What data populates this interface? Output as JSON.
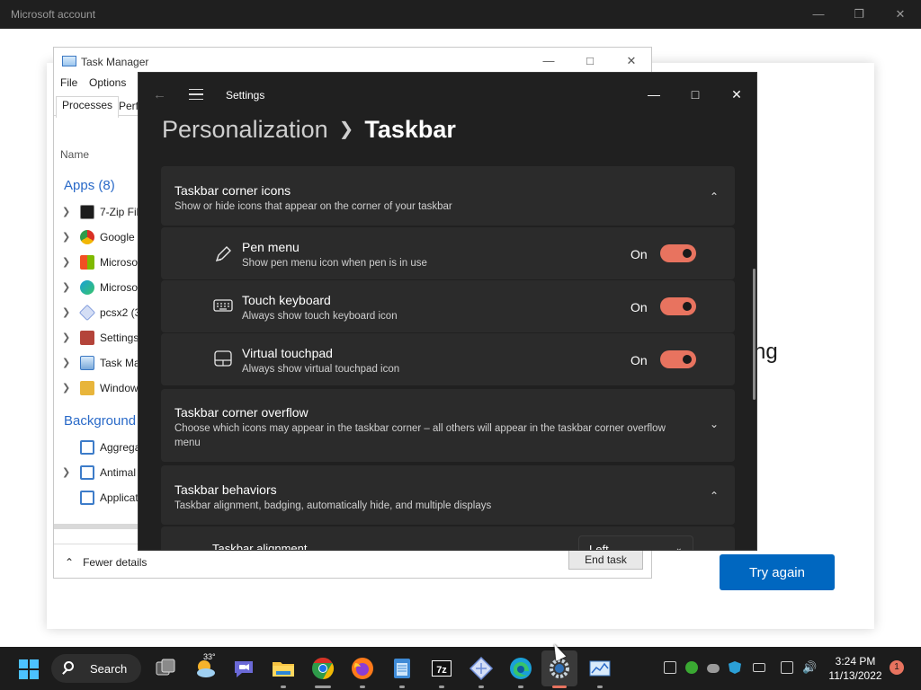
{
  "ms_window": {
    "title": "Microsoft account",
    "heading_fragment": "ng",
    "try_again_label": "Try again"
  },
  "task_manager": {
    "title": "Task Manager",
    "menu": [
      "File",
      "Options"
    ],
    "tabs": [
      "Processes",
      "Perf"
    ],
    "column_name": "Name",
    "apps_header": "Apps (8)",
    "apps": [
      {
        "name": "7-Zip Fil",
        "icon": "7zip-icon",
        "color": "#1d1d1d"
      },
      {
        "name": "Google",
        "icon": "chrome-icon",
        "color": "#2e9b4a"
      },
      {
        "name": "Microso",
        "icon": "microsoft-icon",
        "color": "#e04a1f"
      },
      {
        "name": "Microso",
        "icon": "edge-icon",
        "color": "#1aa0d8"
      },
      {
        "name": "pcsx2 (3",
        "icon": "pcsx2-icon",
        "color": "#6d8cd6"
      },
      {
        "name": "Settings",
        "icon": "settings-icon",
        "color": "#b4443a"
      },
      {
        "name": "Task Ma",
        "icon": "task-manager-icon",
        "color": "#7aa9d9"
      },
      {
        "name": "Window",
        "icon": "folder-icon",
        "color": "#e8b53b"
      }
    ],
    "background_header": "Background",
    "background": [
      {
        "name": "Aggrega",
        "icon": "process-icon",
        "color": "#3d7cc9",
        "expandable": false
      },
      {
        "name": "Antimal",
        "icon": "process-icon",
        "color": "#3d7cc9",
        "expandable": true
      },
      {
        "name": "Applicat",
        "icon": "process-icon",
        "color": "#3d7cc9",
        "expandable": false
      }
    ],
    "fewer_details": "Fewer details",
    "end_task": "End task"
  },
  "settings": {
    "app_title": "Settings",
    "breadcrumb_parent": "Personalization",
    "breadcrumb_current": "Taskbar",
    "corner_icons": {
      "title": "Taskbar corner icons",
      "desc": "Show or hide icons that appear on the corner of your taskbar",
      "items": [
        {
          "title": "Pen menu",
          "desc": "Show pen menu icon when pen is in use",
          "state": "On",
          "icon": "pen-icon"
        },
        {
          "title": "Touch keyboard",
          "desc": "Always show touch keyboard icon",
          "state": "On",
          "icon": "keyboard-icon"
        },
        {
          "title": "Virtual touchpad",
          "desc": "Always show virtual touchpad icon",
          "state": "On",
          "icon": "touchpad-icon"
        }
      ]
    },
    "corner_overflow": {
      "title": "Taskbar corner overflow",
      "desc": "Choose which icons may appear in the taskbar corner – all others will appear in the taskbar corner overflow menu"
    },
    "behaviors": {
      "title": "Taskbar behaviors",
      "desc": "Taskbar alignment, badging, automatically hide, and multiple displays"
    },
    "alignment_label": "Taskbar alignment",
    "alignment_value": "Left",
    "accent_color": "#e8735f"
  },
  "taskbar": {
    "search_label": "Search",
    "weather_temp": "33°",
    "time": "3:24 PM",
    "date": "11/13/2022",
    "notification_count": "1"
  }
}
